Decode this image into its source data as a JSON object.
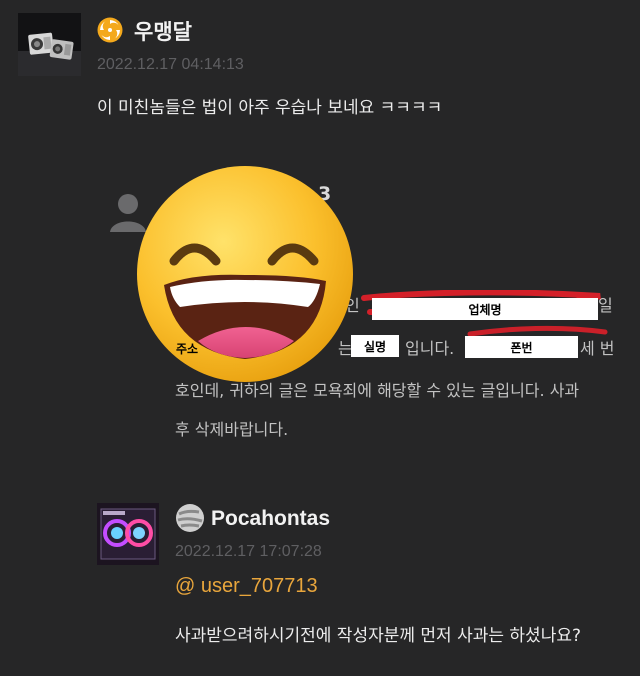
{
  "comment1": {
    "username": "우맹달",
    "timestamp": "2022.12.17 04:14:13",
    "text": "이 미친놈들은 법이 아주 우습나 보네요 ㅋㅋㅋㅋ"
  },
  "quoted": {
    "partial_name": "3",
    "line1_a": "인",
    "line1_b": "일",
    "line2_a": "는",
    "line2_b": "입니다.",
    "line2_c": "세 번",
    "line3": "호인데, 귀하의 글은 모욕죄에 해당할 수 있는 글입니다. 사과",
    "line4": "후 삭제바랍니다.",
    "redactions": {
      "company": "업체명",
      "address": "주소",
      "name": "실명",
      "phone": "폰번"
    }
  },
  "comment2": {
    "username": "Pocahontas",
    "timestamp": "2022.12.17 17:07:28",
    "mention": "@ user_707713",
    "text": "사과받으려하시기전에 작성자분께 먼저 사과는 하셨나요?"
  },
  "colors": {
    "background": "#262627",
    "mention": "#e9a63c",
    "redaction_stroke": "#e8202a"
  },
  "icons": [
    "sun-badge-icon",
    "user-placeholder-icon",
    "grinning-emoji-icon",
    "moon-badge-icon"
  ]
}
